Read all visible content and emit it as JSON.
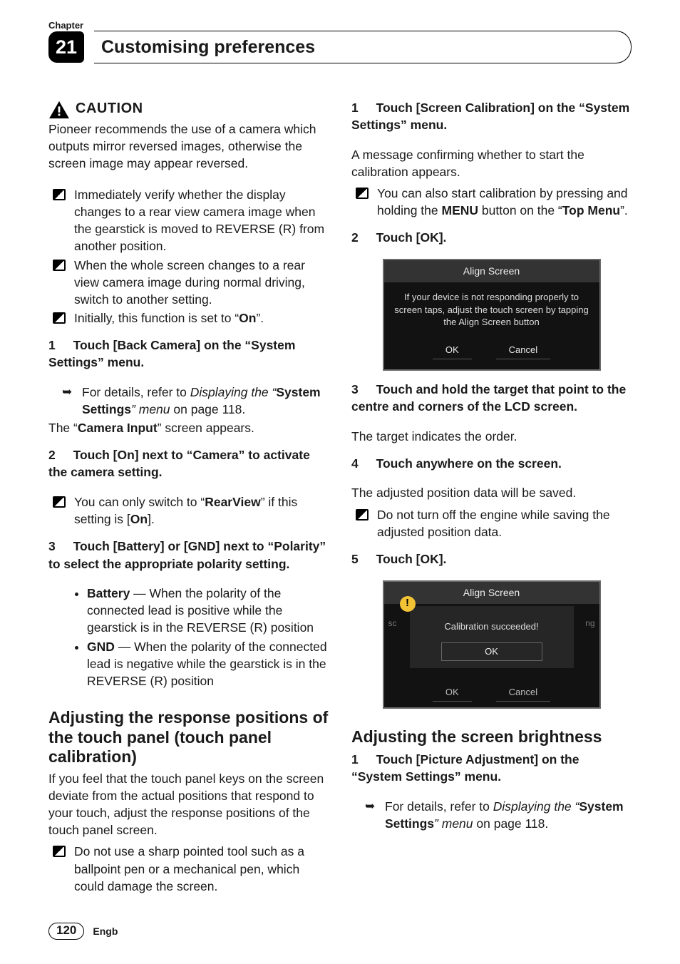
{
  "header": {
    "chapter_label": "Chapter",
    "chapter_number": "21",
    "title": "Customising preferences"
  },
  "left": {
    "caution": "CAUTION",
    "caution_body": "Pioneer recommends the use of a camera which outputs mirror reversed images, otherwise the screen image may appear reversed.",
    "b1_a": "Immediately verify whether the display changes to a rear view camera image when the gearstick is moved to REVERSE (R) from another position.",
    "b1_b": "When the whole screen changes to a rear view camera image during normal driving, switch to another setting.",
    "b1_c_pre": "Initially, this function is set to “",
    "b1_c_b": "On",
    "b1_c_post": "”.",
    "s1_n": "1",
    "s1": "Touch [Back Camera] on the “System Settings” menu.",
    "s1_ref_pre": "For details, refer to ",
    "s1_ref_i": "Displaying the “",
    "s1_ref_b": "System Settings",
    "s1_ref_i2": "” menu",
    "s1_ref_post": " on page 118.",
    "s1_tail_pre": "The “",
    "s1_tail_b": "Camera Input",
    "s1_tail_post": "” screen appears.",
    "s2_n": "2",
    "s2": "Touch [On] next to “Camera” to activate the camera setting.",
    "s2_note_pre": "You can only switch to “",
    "s2_note_b": "RearView",
    "s2_note_mid": "” if this setting is [",
    "s2_note_b2": "On",
    "s2_note_post": "].",
    "s3_n": "3",
    "s3": "Touch [Battery] or [GND] next to “Polarity” to select the appropriate polarity setting.",
    "s3_d1_b": "Battery",
    "s3_d1": " — When the polarity of the connected lead is positive while the gearstick is in the REVERSE (R) position",
    "s3_d2_b": "GND",
    "s3_d2": " — When the polarity of the connected lead is negative while the gearstick is in the REVERSE (R) position",
    "h2": "Adjusting the response positions of the touch panel (touch panel calibration)",
    "h2_body": "If you feel that the touch panel keys on the screen deviate from the actual positions that respond to your touch, adjust the response positions of the touch panel screen.",
    "h2_note": "Do not use a sharp pointed tool such as a ballpoint pen or a mechanical pen, which could damage the screen."
  },
  "right": {
    "r1_n": "1",
    "r1": "Touch [Screen Calibration] on the “System Settings” menu.",
    "r1_body": "A message confirming whether to start the calibration appears.",
    "r1_note_pre": "You can also start calibration by pressing and holding the ",
    "r1_note_b1": "MENU",
    "r1_note_mid": " button on the “",
    "r1_note_b2": "Top Menu",
    "r1_note_post": "”.",
    "r2_n": "2",
    "r2": "Touch [OK].",
    "shot1_title": "Align Screen",
    "shot1_body": "If your device is not responding properly to screen taps, adjust the touch screen by tapping the Align Screen button",
    "shot1_ok": "OK",
    "shot1_cancel": "Cancel",
    "r3_n": "3",
    "r3": "Touch and hold the target that point to the centre and corners of the LCD screen.",
    "r3_body": "The target indicates the order.",
    "r4_n": "4",
    "r4": "Touch anywhere on the screen.",
    "r4_body": "The adjusted position data will be saved.",
    "r4_note": "Do not turn off the engine while saving the adjusted position data.",
    "r5_n": "5",
    "r5": "Touch [OK].",
    "shot2_title": "Align Screen",
    "shot2_msg": "Calibration succeeded!",
    "shot2_ok": "OK",
    "shot2_ok2": "OK",
    "shot2_cancel": "Cancel",
    "shot2_bg_left": "sc",
    "shot2_bg_right": "ng",
    "h2b": "Adjusting the screen brightness",
    "rb1_n": "1",
    "rb1": "Touch [Picture Adjustment] on the “System Settings” menu.",
    "rb1_ref_pre": "For details, refer to ",
    "rb1_ref_i": "Displaying the “",
    "rb1_ref_b": "System Settings",
    "rb1_ref_i2": "” menu",
    "rb1_ref_post": " on page 118."
  },
  "footer": {
    "page": "120",
    "lang": "Engb"
  }
}
